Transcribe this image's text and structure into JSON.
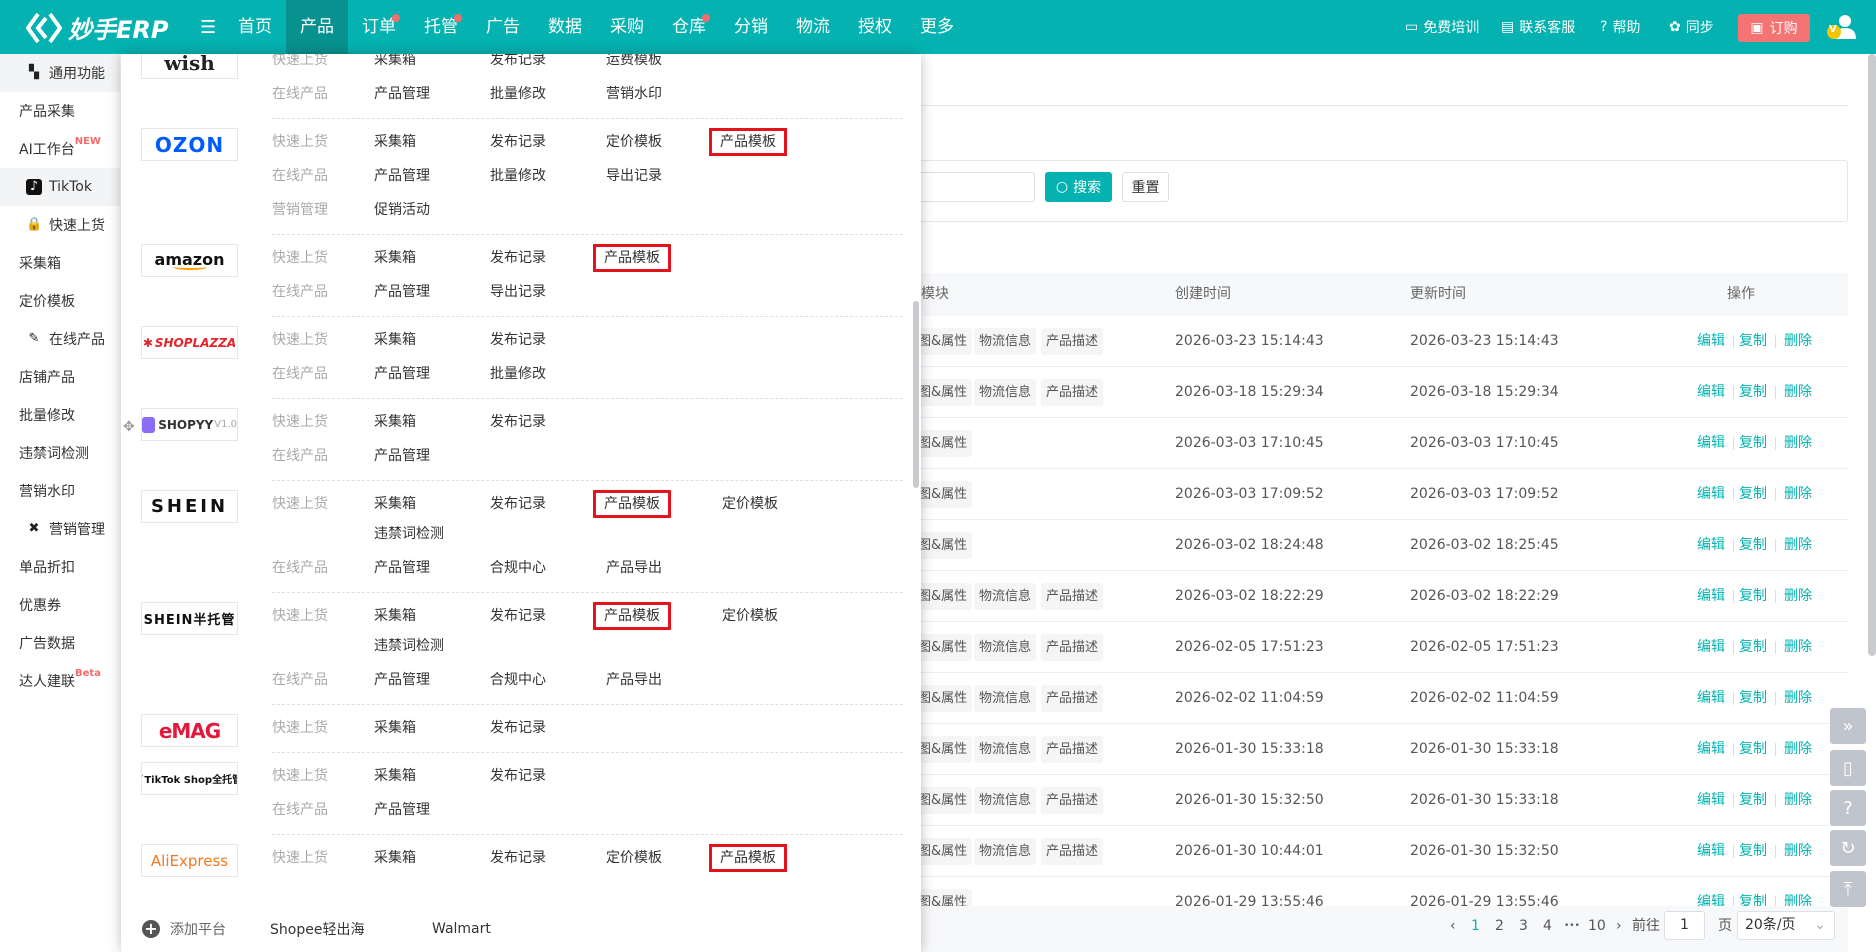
{
  "header": {
    "brand": "妙手ERP",
    "nav": [
      {
        "label": "首页"
      },
      {
        "label": "产品",
        "active": true
      },
      {
        "label": "订单",
        "dot": true
      },
      {
        "label": "托管",
        "dot": true
      },
      {
        "label": "广告"
      },
      {
        "label": "数据"
      },
      {
        "label": "采购"
      },
      {
        "label": "仓库",
        "dot": true
      },
      {
        "label": "分销"
      },
      {
        "label": "物流"
      },
      {
        "label": "授权"
      },
      {
        "label": "更多"
      }
    ],
    "right": {
      "training": "免费培训",
      "support": "联系客服",
      "help": "帮助",
      "sync": "同步",
      "buy": "订购",
      "vip_badge": "V"
    },
    "colors": {
      "primary": "#04b3b1",
      "active": "#07928f",
      "buy": "#f47373",
      "dot": "#f56c6c"
    }
  },
  "sidebar": {
    "items": [
      {
        "label": "通用功能",
        "icon": "grid-icon",
        "gray": true
      },
      {
        "label": "产品采集"
      },
      {
        "label": "AI工作台",
        "badge": "NEW"
      },
      {
        "label": "TikTok",
        "icon": "tiktok-icon",
        "gray": true
      },
      {
        "label": "快速上货",
        "icon": "bag-icon"
      },
      {
        "label": "采集箱"
      },
      {
        "label": "定价模板"
      },
      {
        "label": "在线产品",
        "icon": "edit-icon"
      },
      {
        "label": "店铺产品"
      },
      {
        "label": "批量修改"
      },
      {
        "label": "违禁词检测"
      },
      {
        "label": "营销水印"
      },
      {
        "label": "营销管理",
        "icon": "marketing-icon"
      },
      {
        "label": "单品折扣"
      },
      {
        "label": "优惠券"
      },
      {
        "label": "广告数据"
      },
      {
        "label": "达人建联",
        "badge": "Beta"
      }
    ]
  },
  "platforms": [
    {
      "name": "wish",
      "logo_text": "wish",
      "rows": [
        {
          "label": "快速上货",
          "items": [
            {
              "t": "采集箱"
            },
            {
              "t": "发布记录"
            },
            {
              "t": "运费模板"
            }
          ]
        },
        {
          "label": "在线产品",
          "items": [
            {
              "t": "产品管理"
            },
            {
              "t": "批量修改"
            },
            {
              "t": "营销水印"
            }
          ]
        }
      ]
    },
    {
      "name": "ozon",
      "logo_text": "OZON",
      "rows": [
        {
          "label": "快速上货",
          "items": [
            {
              "t": "采集箱"
            },
            {
              "t": "发布记录"
            },
            {
              "t": "定价模板"
            },
            {
              "t": "产品模板",
              "hl": true
            }
          ]
        },
        {
          "label": "在线产品",
          "items": [
            {
              "t": "产品管理"
            },
            {
              "t": "批量修改"
            },
            {
              "t": "导出记录"
            }
          ]
        },
        {
          "label": "营销管理",
          "items": [
            {
              "t": "促销活动"
            }
          ]
        }
      ]
    },
    {
      "name": "amazon",
      "logo_text": "amazon",
      "rows": [
        {
          "label": "快速上货",
          "items": [
            {
              "t": "采集箱"
            },
            {
              "t": "发布记录"
            },
            {
              "t": "产品模板",
              "hl": true
            }
          ]
        },
        {
          "label": "在线产品",
          "items": [
            {
              "t": "产品管理"
            },
            {
              "t": "导出记录"
            }
          ]
        }
      ]
    },
    {
      "name": "shoplazza",
      "logo_text": "SHOPLAZZA",
      "rows": [
        {
          "label": "快速上货",
          "items": [
            {
              "t": "采集箱"
            },
            {
              "t": "发布记录"
            }
          ]
        },
        {
          "label": "在线产品",
          "items": [
            {
              "t": "产品管理"
            },
            {
              "t": "批量修改"
            }
          ]
        }
      ]
    },
    {
      "name": "shopyy",
      "logo_text": "SHOPYY",
      "logo_sub": "V1.0",
      "rows": [
        {
          "label": "快速上货",
          "items": [
            {
              "t": "采集箱"
            },
            {
              "t": "发布记录"
            }
          ]
        },
        {
          "label": "在线产品",
          "items": [
            {
              "t": "产品管理"
            }
          ]
        }
      ]
    },
    {
      "name": "shein",
      "logo_text": "SHEIN",
      "rows": [
        {
          "label": "快速上货",
          "items": [
            {
              "t": "采集箱"
            },
            {
              "t": "发布记录"
            },
            {
              "t": "产品模板",
              "hl": true
            },
            {
              "t": "定价模板"
            },
            {
              "t": "违禁词检测"
            }
          ]
        },
        {
          "label": "在线产品",
          "items": [
            {
              "t": "产品管理"
            },
            {
              "t": "合规中心"
            },
            {
              "t": "产品导出"
            }
          ]
        }
      ]
    },
    {
      "name": "shein-semi",
      "logo_text": "SHEIN半托管",
      "rows": [
        {
          "label": "快速上货",
          "items": [
            {
              "t": "采集箱"
            },
            {
              "t": "发布记录"
            },
            {
              "t": "产品模板",
              "hl": true
            },
            {
              "t": "定价模板"
            },
            {
              "t": "违禁词检测"
            }
          ]
        },
        {
          "label": "在线产品",
          "items": [
            {
              "t": "产品管理"
            },
            {
              "t": "合规中心"
            },
            {
              "t": "产品导出"
            }
          ]
        }
      ]
    },
    {
      "name": "emag",
      "logo_text": "eMAG",
      "rows": [
        {
          "label": "快速上货",
          "items": [
            {
              "t": "采集箱"
            },
            {
              "t": "发布记录"
            }
          ]
        }
      ]
    },
    {
      "name": "tiktok-shop",
      "logo_text": "TikTok Shop全托管",
      "rows": [
        {
          "label": "快速上货",
          "items": [
            {
              "t": "采集箱"
            },
            {
              "t": "发布记录"
            }
          ]
        },
        {
          "label": "在线产品",
          "items": [
            {
              "t": "产品管理"
            }
          ]
        }
      ]
    },
    {
      "name": "aliexpress",
      "logo_text": "AliExpress",
      "rows": [
        {
          "label": "快速上货",
          "items": [
            {
              "t": "采集箱"
            },
            {
              "t": "发布记录"
            },
            {
              "t": "定价模板"
            },
            {
              "t": "产品模板",
              "hl": true
            }
          ]
        }
      ]
    }
  ],
  "panel_footer": {
    "add": "添加平台",
    "links": [
      "Shopee轻出海",
      "Walmart"
    ]
  },
  "search": {
    "button": "搜索",
    "reset": "重置",
    "input_value": ""
  },
  "table": {
    "headers": {
      "module": "模块",
      "created": "创建时间",
      "updated": "更新时间",
      "actions": "操作"
    },
    "tag_labels": [
      "图&属性",
      "物流信息",
      "产品描述"
    ],
    "action_labels": [
      "编辑",
      "复制",
      "删除"
    ],
    "rows": [
      {
        "tags": 3,
        "created": "2026-03-23 15:14:43",
        "updated": "2026-03-23 15:14:43"
      },
      {
        "tags": 3,
        "created": "2026-03-18 15:29:34",
        "updated": "2026-03-18 15:29:34"
      },
      {
        "tags": 1,
        "created": "2026-03-03 17:10:45",
        "updated": "2026-03-03 17:10:45"
      },
      {
        "tags": 1,
        "created": "2026-03-03 17:09:52",
        "updated": "2026-03-03 17:09:52"
      },
      {
        "tags": 1,
        "created": "2026-03-02 18:24:48",
        "updated": "2026-03-02 18:25:45"
      },
      {
        "tags": 3,
        "created": "2026-03-02 18:22:29",
        "updated": "2026-03-02 18:22:29"
      },
      {
        "tags": 3,
        "created": "2026-02-05 17:51:23",
        "updated": "2026-02-05 17:51:23"
      },
      {
        "tags": 3,
        "created": "2026-02-02 11:04:59",
        "updated": "2026-02-02 11:04:59"
      },
      {
        "tags": 3,
        "created": "2026-01-30 15:33:18",
        "updated": "2026-01-30 15:33:18"
      },
      {
        "tags": 3,
        "created": "2026-01-30 15:32:50",
        "updated": "2026-01-30 15:33:18"
      },
      {
        "tags": 3,
        "created": "2026-01-30 10:44:01",
        "updated": "2026-01-30 15:32:50"
      },
      {
        "tags": 1,
        "created": "2026-01-29 13:55:46",
        "updated": "2026-01-29 13:55:46"
      }
    ]
  },
  "pagination": {
    "prev": "‹",
    "pages": [
      "1",
      "2",
      "3",
      "4"
    ],
    "current": "1",
    "ellipsis": "•••",
    "last": "10",
    "next": "›",
    "goto": "前往",
    "goto_value": "1",
    "page_unit": "页",
    "page_size": "20条/页"
  },
  "float_buttons": [
    {
      "icon": "collapse-icon",
      "glyph": "»"
    },
    {
      "icon": "mobile-icon",
      "glyph": "▯"
    },
    {
      "icon": "help-book-icon",
      "glyph": "?"
    },
    {
      "icon": "refresh-icon",
      "glyph": "↻"
    },
    {
      "icon": "back-to-top-icon",
      "glyph": "⤒"
    }
  ]
}
